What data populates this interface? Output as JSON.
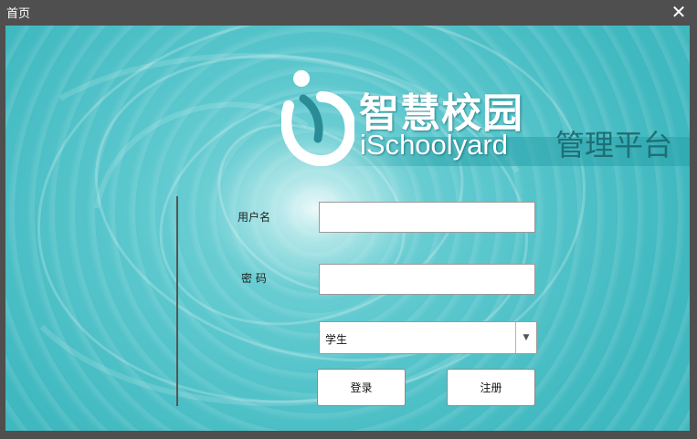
{
  "window": {
    "title": "首页",
    "close_icon": "close-icon"
  },
  "branding": {
    "logo_icon": "ischoolyard-logo",
    "name_cn": "智慧校园",
    "name_en": "iSchoolyard",
    "subtitle": "管理平台"
  },
  "form": {
    "username_label": "用户名",
    "username_value": "",
    "password_label": "密 码",
    "password_value": "",
    "role_selected": "学生",
    "login_label": "登录",
    "register_label": "注册"
  },
  "colors": {
    "accent": "#4fc3c9",
    "subtitle": "#1f6f75"
  }
}
